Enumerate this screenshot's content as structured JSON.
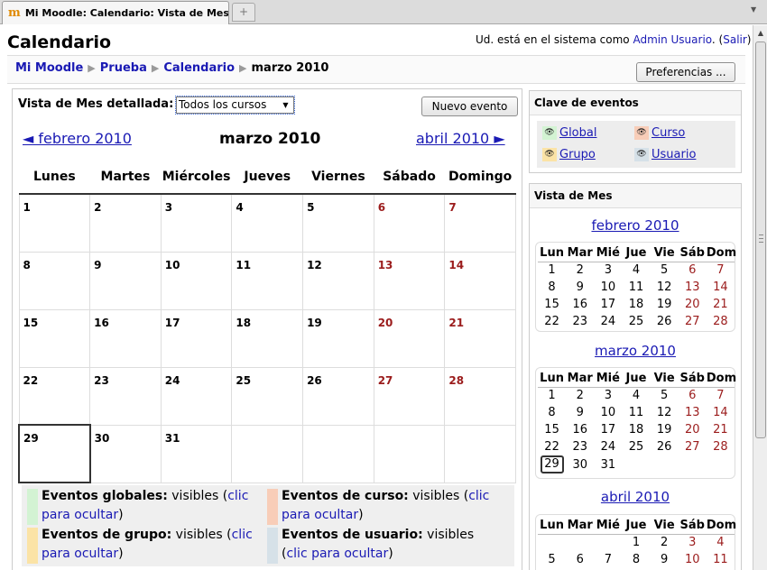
{
  "browser": {
    "tab_title": "Mi Moodle: Calendario: Vista de Mes ...",
    "new_tab": "+"
  },
  "header": {
    "title": "Calendario",
    "login_prefix": "Ud. está en el sistema como ",
    "user_name": "Admin Usuario",
    "logout_open": ". (",
    "logout_label": "Salir",
    "logout_close": ")"
  },
  "breadcrumb": {
    "items": [
      "Mi Moodle",
      "Prueba",
      "Calendario"
    ],
    "current": "marzo 2010",
    "separator": "▶"
  },
  "preferences_button": "Preferencias ...",
  "main": {
    "view_label": "Vista de Mes detallada:",
    "course_select": "Todos los cursos",
    "new_event_button": "Nuevo evento",
    "prev_month": "◄ febrero 2010",
    "current_month": "marzo 2010",
    "next_month": "abril 2010 ►",
    "weekdays": [
      "Lunes",
      "Martes",
      "Miércoles",
      "Jueves",
      "Viernes",
      "Sábado",
      "Domingo"
    ],
    "weeks": [
      [
        "1",
        "2",
        "3",
        "4",
        "5",
        "6",
        "7"
      ],
      [
        "8",
        "9",
        "10",
        "11",
        "12",
        "13",
        "14"
      ],
      [
        "15",
        "16",
        "17",
        "18",
        "19",
        "20",
        "21"
      ],
      [
        "22",
        "23",
        "24",
        "25",
        "26",
        "27",
        "28"
      ],
      [
        "29",
        "30",
        "31",
        "",
        "",
        "",
        ""
      ]
    ],
    "today": "29"
  },
  "legend": {
    "global": {
      "label": "Eventos globales:",
      "state": " visibles (",
      "link": "clic para ocultar",
      "close": ")",
      "color": "#d3f3d3"
    },
    "course": {
      "label": "Eventos de curso:",
      "state": " visibles (",
      "link": "clic para ocultar",
      "close": ")",
      "color": "#f8cdb8"
    },
    "group": {
      "label": "Eventos de grupo:",
      "state": " visibles (",
      "link": "clic para ocultar",
      "close": ")",
      "color": "#fbe3a6"
    },
    "user": {
      "label": "Eventos de usuario:",
      "state": " visibles (",
      "link": "clic para ocultar",
      "close": ")",
      "color": "#d6e1e8"
    }
  },
  "event_key": {
    "title": "Clave de eventos",
    "items": [
      "Global",
      "Curso",
      "Grupo",
      "Usuario"
    ],
    "eye_icon": "👁"
  },
  "month_view": {
    "title": "Vista de Mes",
    "headers": [
      "Lun",
      "Mar",
      "Mié",
      "Jue",
      "Vie",
      "Sáb",
      "Dom"
    ],
    "months": [
      {
        "name": "febrero 2010",
        "weeks": [
          [
            "1",
            "2",
            "3",
            "4",
            "5",
            "6",
            "7"
          ],
          [
            "8",
            "9",
            "10",
            "11",
            "12",
            "13",
            "14"
          ],
          [
            "15",
            "16",
            "17",
            "18",
            "19",
            "20",
            "21"
          ],
          [
            "22",
            "23",
            "24",
            "25",
            "26",
            "27",
            "28"
          ]
        ]
      },
      {
        "name": "marzo 2010",
        "weeks": [
          [
            "1",
            "2",
            "3",
            "4",
            "5",
            "6",
            "7"
          ],
          [
            "8",
            "9",
            "10",
            "11",
            "12",
            "13",
            "14"
          ],
          [
            "15",
            "16",
            "17",
            "18",
            "19",
            "20",
            "21"
          ],
          [
            "22",
            "23",
            "24",
            "25",
            "26",
            "27",
            "28"
          ],
          [
            "29",
            "30",
            "31",
            "",
            "",
            "",
            ""
          ]
        ],
        "today": "29"
      },
      {
        "name": "abril 2010",
        "weeks": [
          [
            "",
            "",
            "",
            "1",
            "2",
            "3",
            "4"
          ],
          [
            "5",
            "6",
            "7",
            "8",
            "9",
            "10",
            "11"
          ]
        ]
      }
    ]
  }
}
